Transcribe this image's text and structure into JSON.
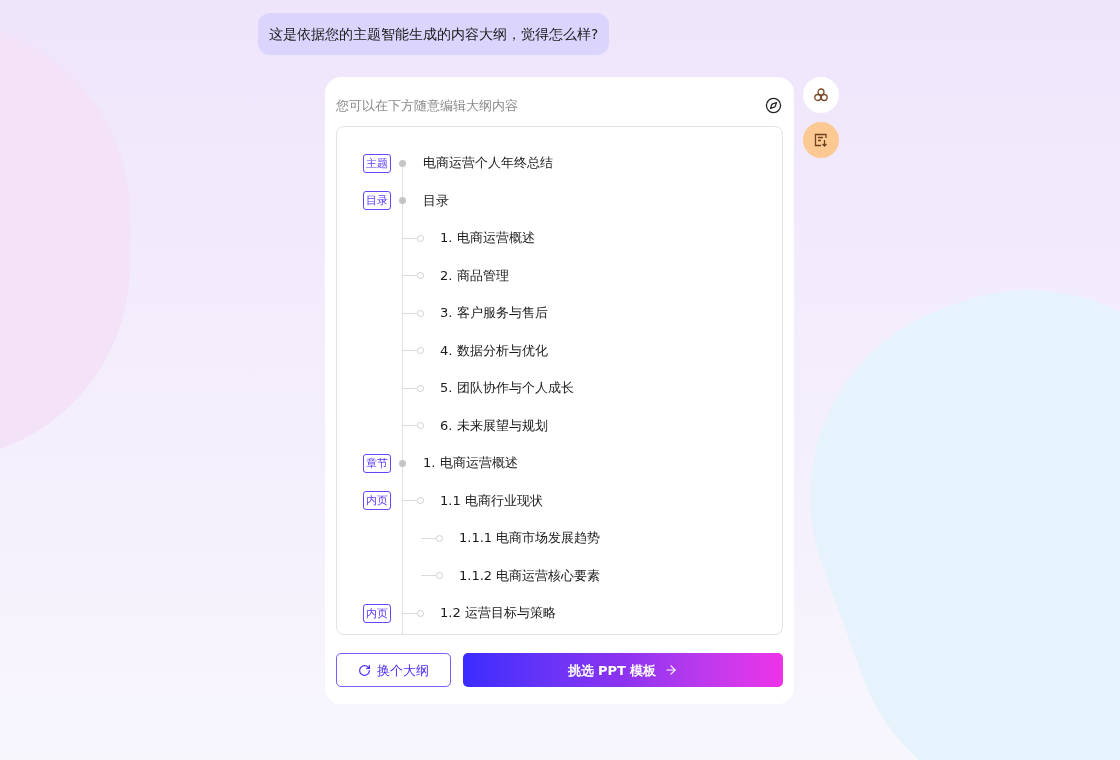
{
  "chat_bubble": {
    "text": "这是依据您的主题智能生成的内容大纲，觉得怎么样?"
  },
  "editor": {
    "hint": "您可以在下方随意编辑大纲内容",
    "outline": [
      {
        "tag": "主题",
        "text": "电商运营个人年终总结"
      },
      {
        "tag": "目录",
        "text": "目录",
        "children": [
          {
            "text": "1. 电商运营概述"
          },
          {
            "text": "2. 商品管理"
          },
          {
            "text": "3. 客户服务与售后"
          },
          {
            "text": "4. 数据分析与优化"
          },
          {
            "text": "5. 团队协作与个人成长"
          },
          {
            "text": "6. 未来展望与规划"
          }
        ]
      },
      {
        "tag": "章节",
        "text": "1. 电商运营概述",
        "children": [
          {
            "tag": "内页",
            "text": "1.1 电商行业现状",
            "children": [
              {
                "text": "1.1.1 电商市场发展趋势"
              },
              {
                "text": "1.1.2 电商运营核心要素"
              }
            ]
          },
          {
            "tag": "内页",
            "text": "1.2 运营目标与策略"
          }
        ]
      }
    ]
  },
  "buttons": [
    {
      "kind": "outline",
      "label": "换个大纲"
    },
    {
      "kind": "primary",
      "label": "挑选 PPT 模板"
    }
  ]
}
